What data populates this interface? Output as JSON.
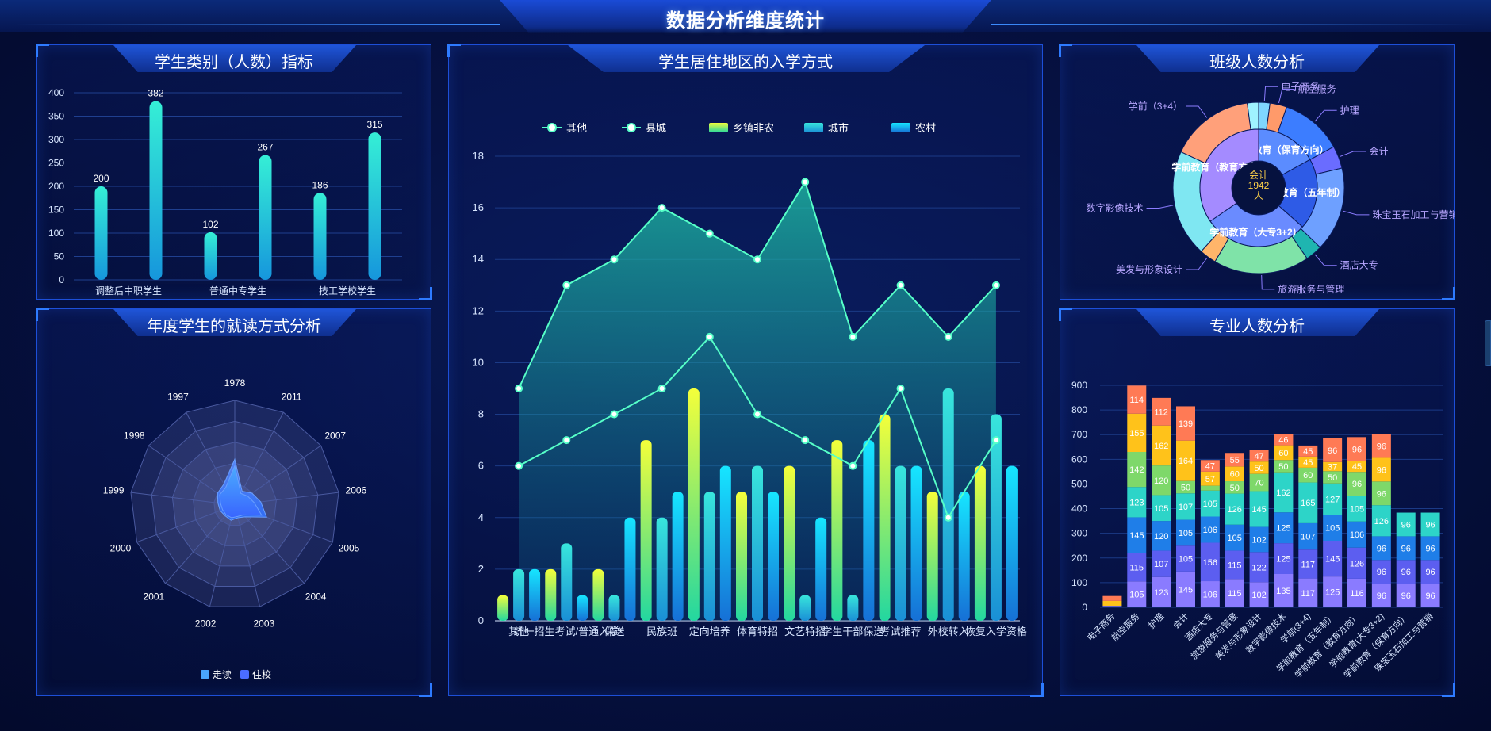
{
  "page": {
    "title": "数据分析维度统计"
  },
  "panels": {
    "category": {
      "title": "学生类别（人数）指标"
    },
    "residence": {
      "title": "学生居住地区的入学方式"
    },
    "class": {
      "title": "班级人数分析"
    },
    "annual": {
      "title": "年度学生的就读方式分析"
    },
    "major": {
      "title": "专业人数分析"
    }
  },
  "colors": {
    "accent": "#2e7bff",
    "bar_cyan": "#2fe0d2",
    "bar_blue": "#1aa0e6",
    "line_green": "#4dffc0",
    "label_purple": "#b7a6ff"
  },
  "chart_data": [
    {
      "id": "category",
      "type": "bar",
      "title": "学生类别（人数）指标",
      "categories": [
        "调整后中职学生",
        "",
        "普通中专学生",
        "",
        "技工学校学生",
        ""
      ],
      "values": [
        200,
        382,
        102,
        267,
        186,
        315
      ],
      "ylim": [
        0,
        400
      ],
      "yticks": [
        0,
        50,
        100,
        150,
        200,
        250,
        300,
        350,
        400
      ],
      "grid": true
    },
    {
      "id": "residence",
      "type": "bar",
      "title": "学生居住地区的入学方式",
      "categories": [
        "其他",
        "统一招生考试/普通入学",
        "保送",
        "民族班",
        "定向培养",
        "体育特招",
        "文艺特招",
        "学生干部保送",
        "考试推荐",
        "外校转入",
        "恢复入学资格"
      ],
      "xtick_labels": [
        "其他",
        "统一招生考试/普通入学",
        "保送",
        "民族班",
        "定向培养",
        "体育特招",
        "文艺特招",
        "学生干部保送",
        "考试推荐",
        "外校转入",
        "恢复入学资格"
      ],
      "legend": [
        "其他",
        "县城",
        "乡镇非农",
        "城市",
        "农村"
      ],
      "legend_position": "top-center",
      "series": [
        {
          "name": "其他",
          "type": "area",
          "values": [
            9,
            13,
            14,
            16,
            15,
            14,
            17,
            11,
            13,
            11,
            13
          ]
        },
        {
          "name": "县城",
          "type": "line",
          "values": [
            6,
            7,
            8,
            9,
            11,
            8,
            7,
            6,
            9,
            4,
            7
          ]
        },
        {
          "name": "乡镇非农",
          "type": "bar",
          "values": [
            1,
            2,
            2,
            7,
            9,
            5,
            6,
            7,
            8,
            5,
            6
          ]
        },
        {
          "name": "城市",
          "type": "bar",
          "values": [
            2,
            3,
            1,
            4,
            5,
            6,
            1,
            1,
            6,
            9,
            8
          ]
        },
        {
          "name": "农村",
          "type": "bar",
          "values": [
            2,
            1,
            4,
            5,
            6,
            5,
            4,
            7,
            6,
            5,
            6
          ]
        }
      ],
      "ylim": [
        0,
        18
      ],
      "yticks": [
        0,
        2,
        4,
        6,
        8,
        10,
        12,
        14,
        16,
        18
      ],
      "grid": true
    },
    {
      "id": "class",
      "type": "pie",
      "title": "班级人数分析",
      "center_label": [
        "会计",
        "1942",
        "人"
      ],
      "inner": [
        {
          "name": "学前教育（保育方向）",
          "value": 330,
          "color": "#5b8cff"
        },
        {
          "name": "学前教育（五年制）",
          "value": 380,
          "color": "#2e5be6"
        },
        {
          "name": "学前教育（大专3+2）",
          "value": 560,
          "color": "#6a8bff"
        },
        {
          "name": "学前教育（教育方向）",
          "value": 672,
          "color": "#a48bff"
        }
      ],
      "outer": [
        {
          "name": "电子商务",
          "value": 40,
          "color": "#7fd6ff"
        },
        {
          "name": "航空服务",
          "value": 60,
          "color": "#ff9a6a"
        },
        {
          "name": "护理",
          "value": 220,
          "color": "#3c7dff"
        },
        {
          "name": "会计",
          "value": 80,
          "color": "#6a6cff"
        },
        {
          "name": "珠宝玉石加工与营销",
          "value": 300,
          "color": "#6ea0ff"
        },
        {
          "name": "酒店大专",
          "value": 60,
          "color": "#1fb5b0"
        },
        {
          "name": "旅游服务与管理",
          "value": 340,
          "color": "#7fe3a8"
        },
        {
          "name": "美发与形象设计",
          "value": 60,
          "color": "#ffb56a"
        },
        {
          "name": "数字影像技术",
          "value": 380,
          "color": "#7fe7f2"
        },
        {
          "name": "学前（3+4）",
          "value": 300,
          "color": "#ffa07a"
        },
        {
          "name": "",
          "value": 40,
          "color": "#9ff3ff"
        }
      ]
    },
    {
      "id": "annual",
      "type": "radar",
      "title": "年度学生的就读方式分析",
      "axes": [
        "1978",
        "2011",
        "2007",
        "2006",
        "2005",
        "2004",
        "2003",
        "2002",
        "2001",
        "2000",
        "1999",
        "1998",
        "1997"
      ],
      "legend": [
        "走读",
        "住校"
      ],
      "legend_position": "bottom-center",
      "max": 10,
      "series": [
        {
          "name": "走读",
          "values": [
            3.5,
            1.2,
            1.6,
            2.0,
            2.6,
            1.2,
            1.0,
            1.2,
            1.1,
            1.2,
            1.3,
            1.6,
            1.8
          ]
        },
        {
          "name": "住校",
          "values": [
            3.0,
            1.0,
            1.2,
            1.5,
            2.2,
            1.0,
            0.9,
            1.0,
            1.0,
            1.0,
            1.1,
            1.4,
            1.5
          ]
        }
      ]
    },
    {
      "id": "major",
      "type": "bar",
      "stacked": true,
      "title": "专业人数分析",
      "categories": [
        "电子商务",
        "航空服务",
        "护理",
        "会计",
        "酒店大专",
        "旅游服务与管理",
        "美发与形象设计",
        "数字影像技术",
        "学前(3+4)",
        "学前教育（五年制）",
        "学前教育（教育方向）",
        "学前教育(大专3+2)",
        "学前教育（保育方向）",
        "珠宝玉石加工与营销"
      ],
      "series": [
        {
          "name": "s1",
          "color": "#8a7bff",
          "values": [
            0,
            105,
            123,
            145,
            106,
            115,
            102,
            135,
            117,
            125,
            116,
            96,
            96,
            96
          ]
        },
        {
          "name": "s2",
          "color": "#5c5ef0",
          "values": [
            6,
            115,
            107,
            105,
            156,
            115,
            122,
            125,
            117,
            145,
            126,
            96,
            96,
            96
          ]
        },
        {
          "name": "s3",
          "color": "#1f7ee8",
          "values": [
            0,
            145,
            120,
            105,
            106,
            105,
            102,
            125,
            107,
            105,
            106,
            96,
            96,
            96
          ]
        },
        {
          "name": "s4",
          "color": "#2dd4c8",
          "values": [
            0,
            123,
            105,
            107,
            105,
            126,
            145,
            162,
            165,
            127,
            105,
            126,
            96,
            96
          ]
        },
        {
          "name": "s5",
          "color": "#7ed86a",
          "values": [
            0,
            142,
            120,
            50,
            20,
            50,
            70,
            50,
            60,
            50,
            96,
            96,
            0,
            0
          ]
        },
        {
          "name": "s6",
          "color": "#ffc21a",
          "values": [
            20,
            155,
            162,
            164,
            57,
            60,
            50,
            60,
            45,
            37,
            45,
            96,
            0,
            0
          ]
        },
        {
          "name": "s7",
          "color": "#ff7a55",
          "values": [
            20,
            114,
            112,
            139,
            47,
            55,
            47,
            46,
            45,
            96,
            96,
            96,
            0,
            0
          ]
        }
      ],
      "ylim": [
        0,
        900
      ],
      "yticks": [
        0,
        100,
        200,
        300,
        400,
        500,
        600,
        700,
        800,
        900
      ],
      "grid": true
    }
  ]
}
